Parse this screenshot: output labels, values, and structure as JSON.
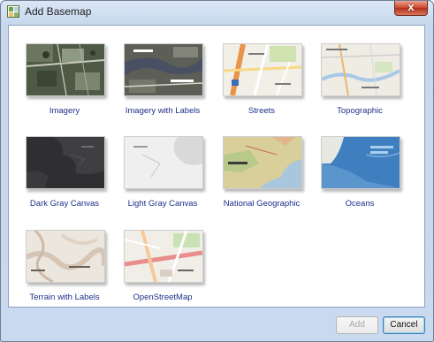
{
  "window": {
    "title": "Add Basemap",
    "close_label": "x"
  },
  "gallery": [
    {
      "label": "Imagery",
      "icon": "imagery-thumbnail"
    },
    {
      "label": "Imagery with Labels",
      "icon": "imagery-labels-thumbnail"
    },
    {
      "label": "Streets",
      "icon": "streets-thumbnail"
    },
    {
      "label": "Topographic",
      "icon": "topographic-thumbnail"
    },
    {
      "label": "Dark Gray Canvas",
      "icon": "dark-gray-canvas-thumbnail"
    },
    {
      "label": "Light Gray Canvas",
      "icon": "light-gray-canvas-thumbnail"
    },
    {
      "label": "National Geographic",
      "icon": "national-geographic-thumbnail"
    },
    {
      "label": "Oceans",
      "icon": "oceans-thumbnail"
    },
    {
      "label": "Terrain with Labels",
      "icon": "terrain-labels-thumbnail"
    },
    {
      "label": "OpenStreetMap",
      "icon": "openstreetmap-thumbnail"
    }
  ],
  "buttons": {
    "add": "Add",
    "cancel": "Cancel",
    "add_enabled": false
  },
  "colors": {
    "label_text": "#1c2f8a",
    "window_frame": "#c9d9ef"
  }
}
